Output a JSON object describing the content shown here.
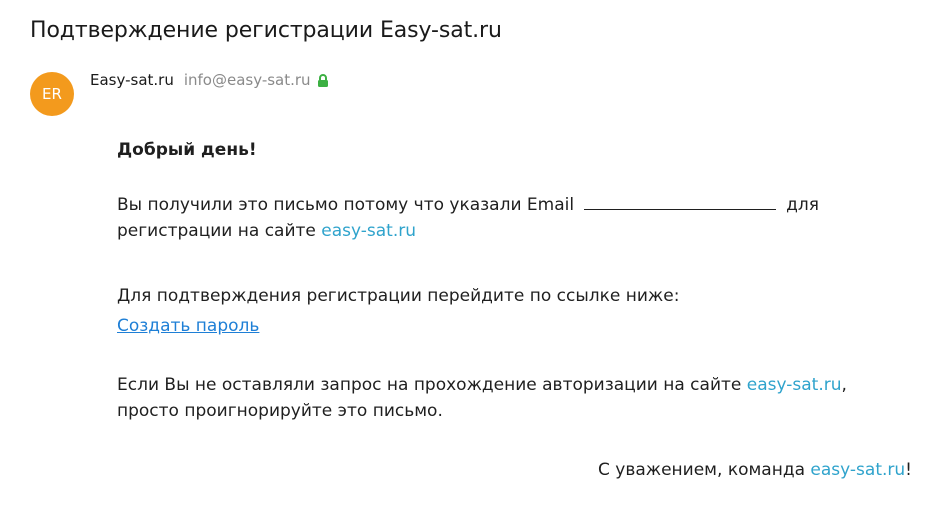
{
  "email": {
    "subject": "Подтверждение регистрации Easy-sat.ru",
    "sender": {
      "avatar_initials": "ER",
      "avatar_color": "#f39a1d",
      "name": "Easy-sat.ru",
      "address": "info@easy-sat.ru",
      "verified_icon": "lock-icon",
      "verified_color": "#3cb043"
    },
    "body": {
      "greeting": "Добрый день!",
      "para1_prefix": "Вы получили это письмо потому что указали Email",
      "para1_after_blank": "для",
      "para1_line2_prefix": "регистрации на сайте",
      "site_link": "easy-sat.ru",
      "para2": "Для подтверждения регистрации перейдите по ссылке ниже:",
      "action_link": "Создать пароль",
      "para3_prefix": "Если Вы не оставляли запрос на прохождение авторизации на сайте",
      "para3_comma": ",",
      "para3_line2": "просто проигнорируйте это письмо.",
      "signoff_prefix": "С уважением, команда",
      "signoff_suffix": "!"
    },
    "colors": {
      "site_link": "#2fa3cc",
      "action_link": "#1e7fd6"
    }
  }
}
